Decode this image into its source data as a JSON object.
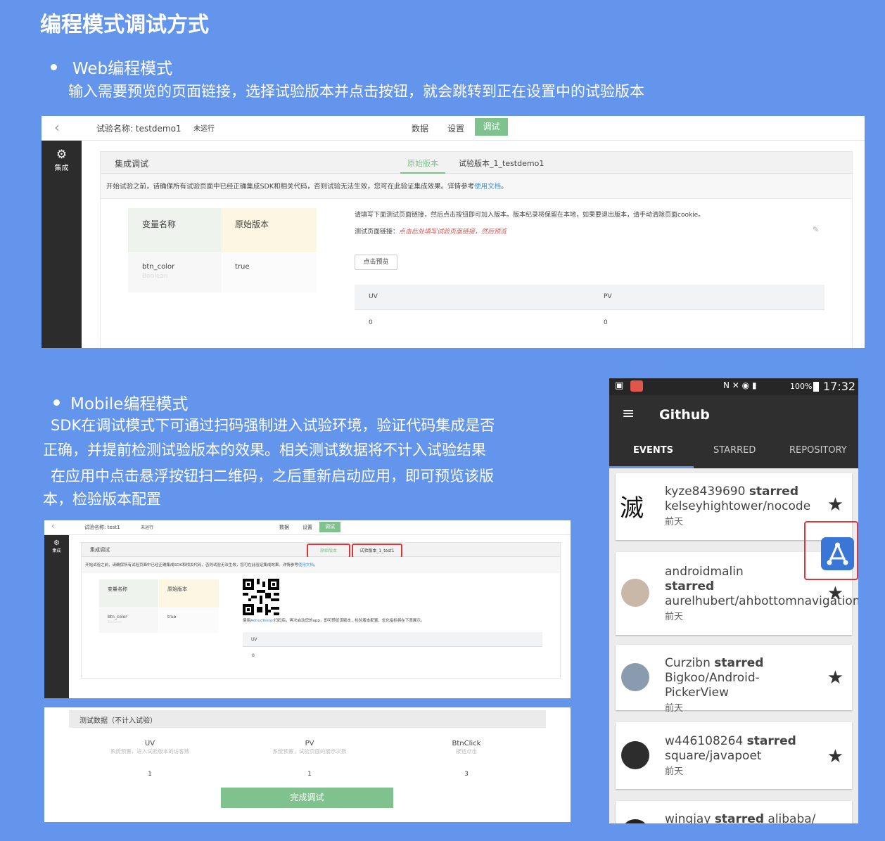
{
  "title": "编程模式调试方式",
  "web_section": {
    "heading": "Web编程模式",
    "description": "输入需要预览的页面链接，选择试验版本并点击按钮，就会跳转到正在设置中的试验版本"
  },
  "web_ui": {
    "back_icon": "chevron-left-icon",
    "experiment_name": "试验名称: testdemo1",
    "status": "未运行",
    "nav": {
      "data": "数据",
      "settings": "设置",
      "debug": "调试"
    },
    "sidebar": {
      "icon": "gear-icon",
      "label": "集成"
    },
    "card_title": "集成调试",
    "tabs": [
      "原始版本",
      "试验版本_1_testdemo1"
    ],
    "notice_prefix": "开始试验之前，请确保所有试验页面中已经正确集成SDK和相关代码，否则试验无法生效，您可在此验证集成效果。详情参考",
    "notice_link": "使用文档",
    "notice_suffix": "。",
    "var_table": {
      "headers": [
        "变量名称",
        "原始版本"
      ],
      "var_name": "btn_color",
      "var_type": "Boolean",
      "var_value": "true"
    },
    "instruction": "请填写下面测试页面链接，然后点击按钮即可加入版本。版本纪录将保留在本地，如果要退出版本，请手动清除页面cookie。",
    "url_label": "测试页面链接：",
    "url_placeholder": "点击此处填写试验页面链接，然后预览",
    "preview_button": "点击预览",
    "stats_headers": [
      "UV",
      "PV"
    ],
    "stats_values": [
      "0",
      "0"
    ]
  },
  "mobile_section": {
    "heading": "Mobile编程模式",
    "para1_line1": "SDK在调试模式下可通过扫码强制进入试验环境，验证代码集成是否",
    "para1_line2": "正确，并提前检测试验版本的效果。相关测试数据将不计入试验结果",
    "para2_line1": "在应用中点击悬浮按钮扫二维码，之后重新启动应用，即可预览该版",
    "para2_line2": "本，检验版本配置"
  },
  "mobile_ui": {
    "experiment_name": "试验名称: test1",
    "status": "未运行",
    "nav": {
      "data": "数据",
      "settings": "设置",
      "debug": "调试"
    },
    "sidebar_label": "集成",
    "card_title": "集成调试",
    "tabs": [
      "原始版本",
      "试验版本_1_test1"
    ],
    "notice_prefix": "开始试验之前，请确保所有试验页面中已经正确集成SDK和相关代码，否则试验无法生效，您可在此验证集成效果。详情参考",
    "notice_link": "使用文档",
    "notice_suffix": "。",
    "var_headers": [
      "变量名称",
      "原始版本"
    ],
    "var_name": "btn_color",
    "var_type": "Boolean",
    "var_value": "true",
    "scan_prefix": "使用",
    "scan_link": "AdhocTester",
    "scan_suffix": "扫码后，再次启动您的app，即可预览该版本，检验版本配置，优化指标将在下表展示。",
    "uv_label": "UV",
    "uv_value": "0"
  },
  "test_data": {
    "title": "测试数据（不计入试验）",
    "columns": [
      {
        "label": "UV",
        "desc": "系统预置，进入试验版本的访客数",
        "value": "1"
      },
      {
        "label": "PV",
        "desc": "系统预置，试验页面的展示次数",
        "value": "1"
      },
      {
        "label": "BtnClick",
        "desc": "按钮点击",
        "value": "3"
      }
    ],
    "finish_button": "完成调试"
  },
  "phone": {
    "status_right": "100%",
    "clock": "17:32",
    "app_title": "Github",
    "tabs": [
      "EVENTS",
      "STARRED",
      "REPOSITORY"
    ],
    "events": [
      {
        "user": "kyze8439690",
        "action": "starred",
        "repo": "kelseyhightower/nocode",
        "when": "前天",
        "avatar_char": "滅"
      },
      {
        "user": "androidmalin",
        "action": "starred",
        "repo": "aurelhubert/ahbottomnavigation",
        "when": "前天"
      },
      {
        "user": "Curzibn",
        "action": "starred",
        "repo": "Bigkoo/Android-PickerView",
        "when": "前天"
      },
      {
        "user": "w446108264",
        "action": "starred",
        "repo": "square/javapoet",
        "when": "前天"
      },
      {
        "user": "wingjay",
        "action": "starred",
        "repo": "alibaba/"
      }
    ]
  },
  "colors": {
    "background": "#6495ed",
    "accent_green": "#7fc28d",
    "sidebar": "#2c2c2c",
    "highlight_red": "#d9383a"
  }
}
